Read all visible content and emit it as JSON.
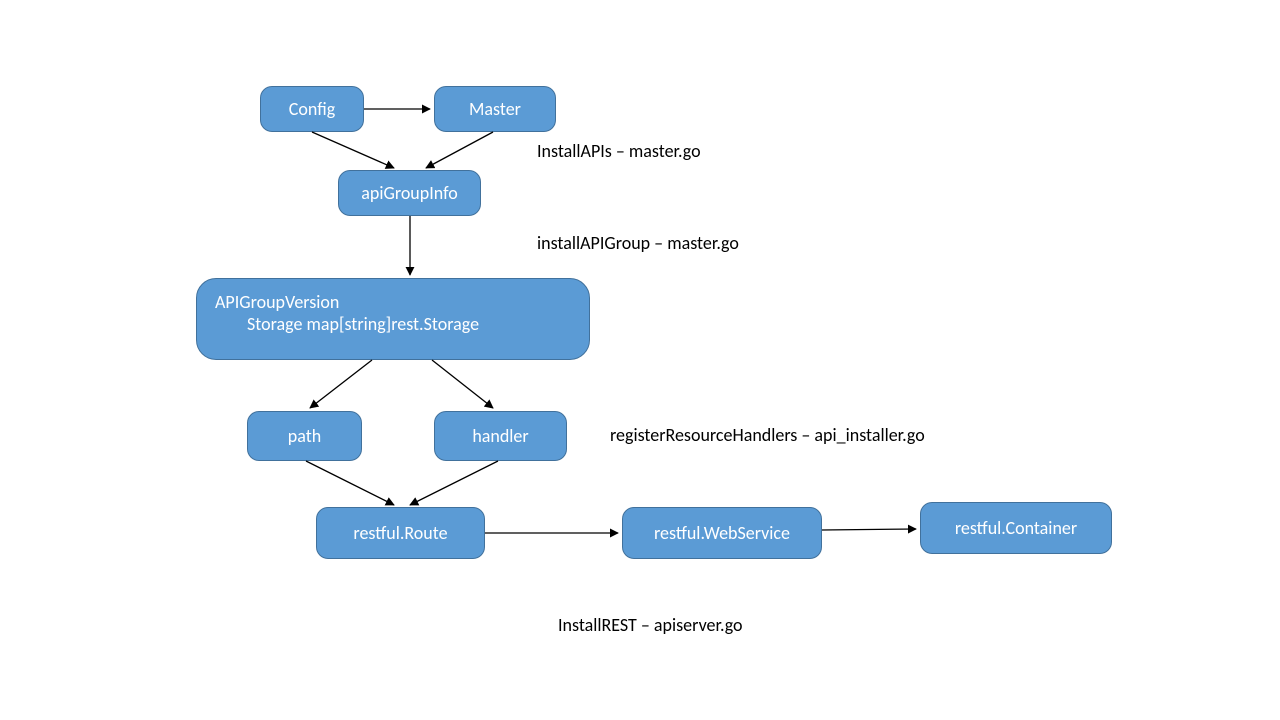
{
  "chart_data": {
    "type": "diagram",
    "nodes": [
      {
        "id": "config",
        "label": "Config"
      },
      {
        "id": "master",
        "label": "Master"
      },
      {
        "id": "apiGroupInfo",
        "label": "apiGroupInfo"
      },
      {
        "id": "apiGroupVersion",
        "label_line1": "APIGroupVersion",
        "label_line2": "Storage map[string]rest.Storage"
      },
      {
        "id": "path",
        "label": "path"
      },
      {
        "id": "handler",
        "label": "handler"
      },
      {
        "id": "restfulRoute",
        "label": "restful.Route"
      },
      {
        "id": "restfulWebService",
        "label": "restful.WebService"
      },
      {
        "id": "restfulContainer",
        "label": "restful.Container"
      }
    ],
    "edges": [
      {
        "from": "config",
        "to": "master"
      },
      {
        "from": "config",
        "to": "apiGroupInfo"
      },
      {
        "from": "master",
        "to": "apiGroupInfo"
      },
      {
        "from": "apiGroupInfo",
        "to": "apiGroupVersion"
      },
      {
        "from": "apiGroupVersion",
        "to": "path"
      },
      {
        "from": "apiGroupVersion",
        "to": "handler"
      },
      {
        "from": "path",
        "to": "restfulRoute"
      },
      {
        "from": "handler",
        "to": "restfulRoute"
      },
      {
        "from": "restfulRoute",
        "to": "restfulWebService"
      },
      {
        "from": "restfulWebService",
        "to": "restfulContainer"
      }
    ],
    "annotations": [
      {
        "text": "InstallAPIs – master.go",
        "near_edge": "master→apiGroupInfo"
      },
      {
        "text": "installAPIGroup – master.go",
        "near_edge": "apiGroupInfo→apiGroupVersion"
      },
      {
        "text": "registerResourceHandlers – api_installer.go",
        "near_edge": "apiGroupVersion→handler"
      },
      {
        "text": "InstallREST – apiserver.go",
        "near_edge": "restfulRoute→restfulWebService"
      }
    ]
  },
  "nodes": {
    "config": "Config",
    "master": "Master",
    "apiGroupInfo": "apiGroupInfo",
    "apiGroupVersion_l1": "APIGroupVersion",
    "apiGroupVersion_l2": "Storage map[string]rest.Storage",
    "path": "path",
    "handler": "handler",
    "restfulRoute": "restful.Route",
    "restfulWebService": "restful.WebService",
    "restfulContainer": "restful.Container"
  },
  "labels": {
    "installAPIs": "InstallAPIs – master.go",
    "installAPIGroup": "installAPIGroup – master.go",
    "registerResourceHandlers": "registerResourceHandlers – api_installer.go",
    "installREST": "InstallREST – apiserver.go"
  }
}
